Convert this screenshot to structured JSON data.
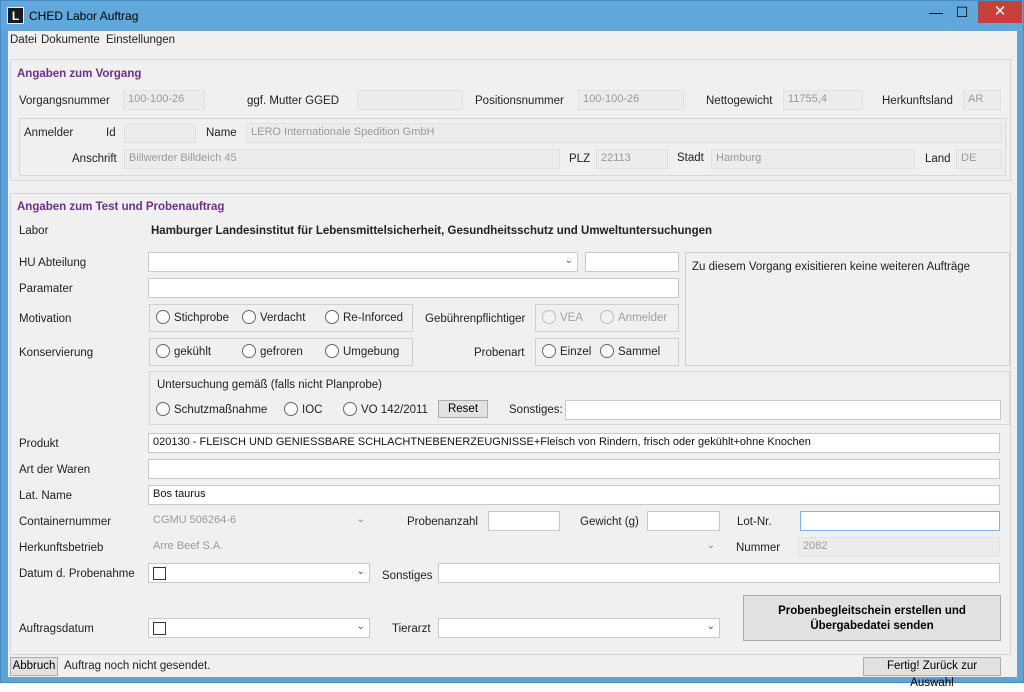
{
  "window": {
    "title": "CHED Labor Auftrag",
    "app_icon_letter": "L"
  },
  "menu": [
    "Datei",
    "Dokumente",
    "Einstellungen"
  ],
  "vorgang": {
    "title": "Angaben zum Vorgang",
    "vorgangsnummer_label": "Vorgangsnummer",
    "vorgangsnummer": "100-100-26",
    "mutter_label": "ggf. Mutter GGED",
    "mutter": "",
    "positionsnummer_label": "Positionsnummer",
    "positionsnummer": "100-100-26",
    "nettogewicht_label": "Nettogewicht",
    "nettogewicht": "11755,4",
    "herkunftsland_label": "Herkunftsland",
    "herkunftsland": "AR",
    "anmelder_label": "Anmelder",
    "id_label": "Id",
    "id": "",
    "name_label": "Name",
    "name": "LERO Internationale Spedition GmbH",
    "anschrift_label": "Anschrift",
    "anschrift": "Billwerder Billdeich 45",
    "plz_label": "PLZ",
    "plz": "22113",
    "stadt_label": "Stadt",
    "stadt": "Hamburg",
    "land_label": "Land",
    "land": "DE"
  },
  "test": {
    "title": "Angaben zum Test und Probenauftrag",
    "labor_label": "Labor",
    "labor": "Hamburger Landesinstitut für Lebensmittelsicherheit, Gesundheitsschutz und Umweltuntersuchungen",
    "hu_label": "HU Abteilung",
    "hu_value": "",
    "hu_extra": "",
    "paramater_label": "Paramater",
    "paramater": "",
    "info_text": "Zu diesem Vorgang exisitieren keine weiteren Aufträge",
    "motivation_label": "Motivation",
    "motivation_options": [
      "Stichprobe",
      "Verdacht",
      "Re-Inforced"
    ],
    "gebuehren_label": "Gebührenpflichtiger",
    "gebuehren_options": [
      "VEA",
      "Anmelder"
    ],
    "konservierung_label": "Konservierung",
    "konservierung_options": [
      "gekühlt",
      "gefroren",
      "Umgebung"
    ],
    "probenart_label": "Probenart",
    "probenart_options": [
      "Einzel",
      "Sammel"
    ],
    "untersuchung_title": "Untersuchung gemäß (falls nicht Planprobe)",
    "untersuchung_options": [
      "Schutzmaßnahme",
      "IOC",
      "VO 142/2011"
    ],
    "reset_label": "Reset",
    "sonstiges1_label": "Sonstiges:",
    "sonstiges1": "",
    "produkt_label": "Produkt",
    "produkt": "020130 - FLEISCH UND GENIESSBARE SCHLACHTNEBENERZEUGNISSE+Fleisch von Rindern, frisch oder gekühlt+ohne Knochen",
    "art_label": "Art der Waren",
    "art": "",
    "lat_label": "Lat. Name",
    "lat": "Bos taurus",
    "container_label": "Containernummer",
    "container": "CGMU 506264-6",
    "probenanzahl_label": "Probenanzahl",
    "probenanzahl": "",
    "gewicht_label": "Gewicht (g)",
    "gewicht": "",
    "lot_label": "Lot-Nr.",
    "lot": "",
    "herkunftsbetrieb_label": "Herkunftsbetrieb",
    "herkunftsbetrieb": "Arre Beef S.A.",
    "nummer_label": "Nummer",
    "nummer": "2082",
    "datum_label": "Datum d. Probenahme",
    "sonstiges2_label": "Sonstiges",
    "sonstiges2": "",
    "auftragsdatum_label": "Auftragsdatum",
    "tierarzt_label": "Tierarzt",
    "tierarzt": "",
    "create_button_line1": "Probenbegleitschein erstellen und",
    "create_button_line2": "Übergabedatei senden"
  },
  "footer": {
    "abbruch_label": "Abbruch",
    "status": "Auftrag noch nicht gesendet.",
    "fertig_label": "Fertig! Zurück zur Auswahl"
  }
}
